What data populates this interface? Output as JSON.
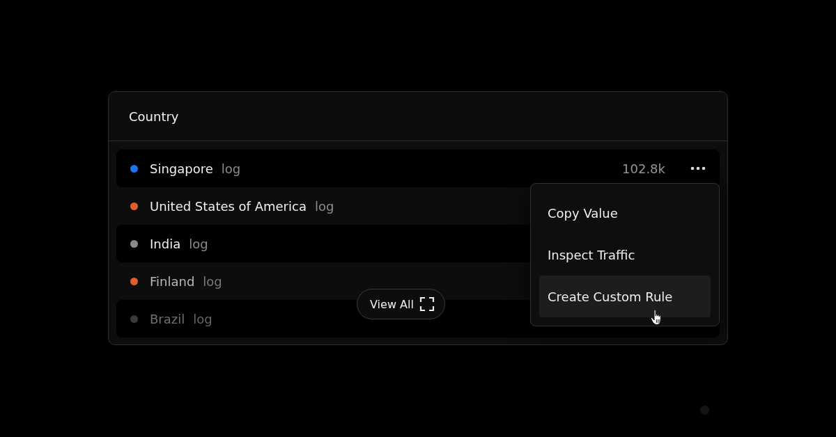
{
  "card": {
    "title": "Country"
  },
  "rows": [
    {
      "name": "Singapore",
      "tag": "log",
      "color": "#1a73f0",
      "value": "102.8k"
    },
    {
      "name": "United States of America",
      "tag": "log",
      "color": "#e35d2a"
    },
    {
      "name": "India",
      "tag": "log",
      "color": "#8a888e"
    },
    {
      "name": "Finland",
      "tag": "log",
      "color": "#e35d2a"
    },
    {
      "name": "Brazil",
      "tag": "log",
      "color": "#3a3a3a"
    }
  ],
  "view_all": {
    "label": "View All"
  },
  "menu": [
    {
      "label": "Copy Value",
      "selected": false
    },
    {
      "label": "Inspect Traffic",
      "selected": false
    },
    {
      "label": "Create Custom Rule",
      "selected": true
    }
  ]
}
